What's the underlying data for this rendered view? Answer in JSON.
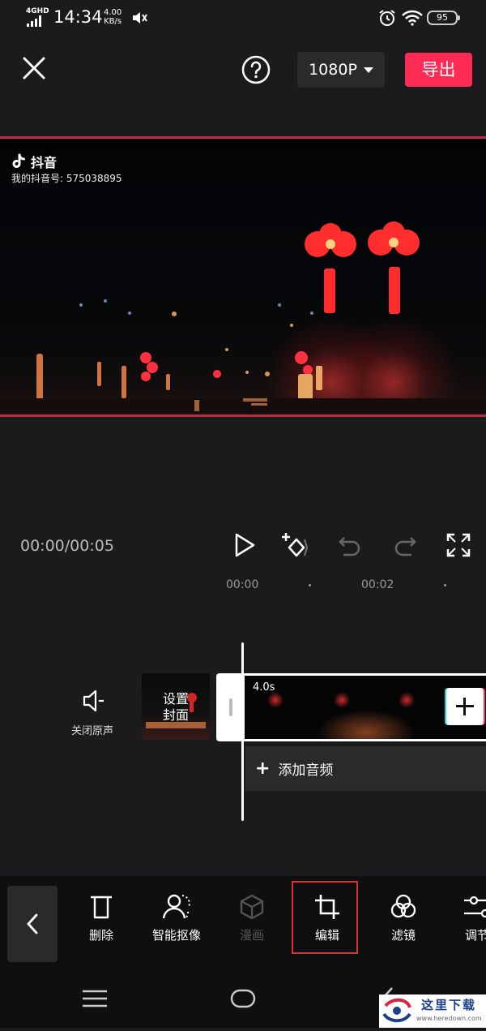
{
  "status_bar": {
    "network": "4GHD",
    "time": "14:34",
    "speed_value": "4.00",
    "speed_unit": "KB/s",
    "battery": "95",
    "icons": [
      "signal-icon",
      "volume-mute-icon",
      "alarm-icon",
      "wifi-icon",
      "battery-icon"
    ]
  },
  "top_bar": {
    "close_icon": "close-icon",
    "help_icon": "help-icon",
    "resolution": "1080P",
    "export_label": "导出",
    "export_color": "#fe2c55"
  },
  "preview": {
    "watermark_app": "抖音",
    "watermark_id": "我的抖音号: 575038895",
    "border_color": "#c12a43"
  },
  "playback": {
    "timecode": "00:00/00:05",
    "icons": [
      "play-icon",
      "keyframe-icon",
      "undo-icon",
      "redo-icon",
      "fullscreen-icon"
    ]
  },
  "timeline": {
    "ticks": [
      "00:00",
      "00:02"
    ],
    "mute_label": "关闭原声",
    "cover_label_line1": "设置",
    "cover_label_line2": "封面",
    "clip_duration": "4.0s",
    "add_audio_label": "添加音频"
  },
  "toolbar": {
    "items": [
      {
        "label": "删除",
        "icon": "delete-icon"
      },
      {
        "label": "智能抠像",
        "icon": "smart-cutout-icon"
      },
      {
        "label": "漫画",
        "icon": "comic-icon",
        "disabled": true
      },
      {
        "label": "编辑",
        "icon": "crop-icon",
        "highlighted": true
      },
      {
        "label": "滤镜",
        "icon": "filter-icon"
      },
      {
        "label": "调节",
        "icon": "adjust-icon"
      }
    ],
    "highlight_color": "#e03131"
  },
  "nav_bar": {
    "icons": [
      "menu-icon",
      "home-icon",
      "back-icon"
    ]
  },
  "watermark_site": {
    "text": "这里下载",
    "url": "www.heredown.com"
  }
}
